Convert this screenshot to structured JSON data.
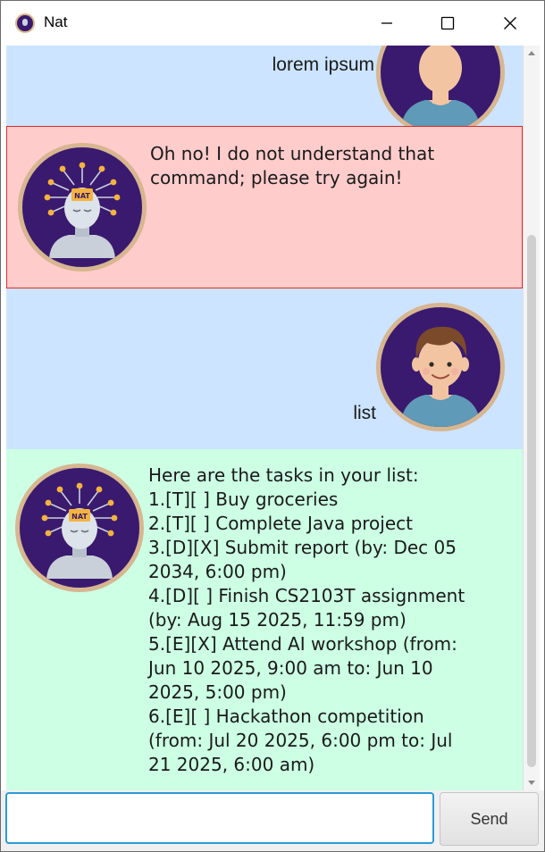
{
  "window": {
    "title": "Nat"
  },
  "messages": [
    {
      "sender": "user",
      "text": "lorem ipsum"
    },
    {
      "sender": "bot",
      "type": "error",
      "text": "Oh no! I do not understand that\ncommand; please try again!"
    },
    {
      "sender": "user",
      "text": "list"
    },
    {
      "sender": "bot",
      "type": "response",
      "text": "Here are the tasks in your list:\n1.[T][ ] Buy groceries\n2.[T][ ] Complete Java project\n3.[D][X] Submit report (by: Dec 05\n2034, 6:00 pm)\n4.[D][ ] Finish CS2103T assignment\n(by: Aug 15 2025, 11:59 pm)\n5.[E][X] Attend AI workshop (from:\nJun 10 2025, 9:00 am to: Jun 10\n2025, 5:00 pm)\n6.[E][ ] Hackathon competition\n(from: Jul 20 2025, 6:00 pm to: Jul\n21 2025, 6:00 am)"
    }
  ],
  "bot_avatar": {
    "badge": "NAT"
  },
  "input": {
    "value": "",
    "placeholder": ""
  },
  "send_button": {
    "label": "Send"
  },
  "colors": {
    "user_bg": "#cce4ff",
    "error_bg": "#ffcccc",
    "error_border": "#e02a2a",
    "bot_bg": "#ccffe4",
    "avatar_bg": "#3a1a6e",
    "avatar_ring": "#d7b690",
    "input_focus": "#2a9bd8"
  }
}
